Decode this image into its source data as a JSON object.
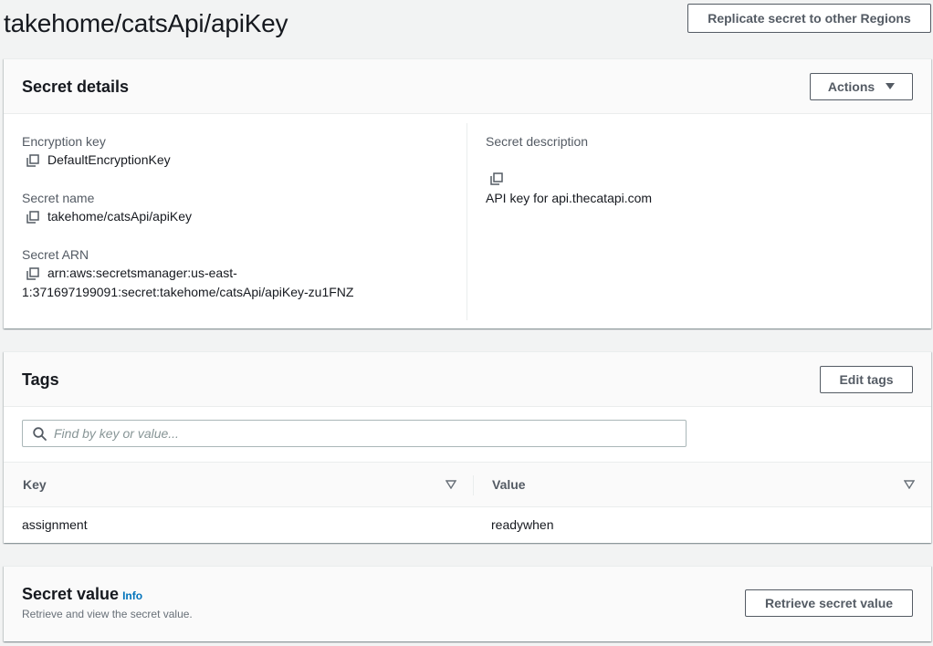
{
  "page": {
    "title": "takehome/catsApi/apiKey",
    "replicate_button": "Replicate secret to other Regions"
  },
  "secret_details": {
    "title": "Secret details",
    "actions_button": "Actions",
    "encryption_key": {
      "label": "Encryption key",
      "value": "DefaultEncryptionKey"
    },
    "secret_name": {
      "label": "Secret name",
      "value": "takehome/catsApi/apiKey"
    },
    "secret_arn": {
      "label": "Secret ARN",
      "value_line1": "arn:aws:secretsmanager:us-east-",
      "value_line2": "1:371697199091:secret:takehome/catsApi/apiKey-zu1FNZ"
    },
    "secret_description": {
      "label": "Secret description",
      "value": "API key for api.thecatapi.com"
    }
  },
  "tags": {
    "title": "Tags",
    "edit_button": "Edit tags",
    "search_placeholder": "Find by key or value...",
    "columns": [
      "Key",
      "Value"
    ],
    "rows": [
      {
        "key": "assignment",
        "value": "readywhen"
      }
    ]
  },
  "secret_value": {
    "title": "Secret value",
    "info_link": "Info",
    "subtitle": "Retrieve and view the secret value.",
    "retrieve_button": "Retrieve secret value"
  },
  "colors": {
    "background": "#f2f3f3",
    "panel_header": "#fafafa",
    "button_border": "#545b64",
    "link": "#0073bb"
  },
  "icons": [
    "copy-icon",
    "search-icon",
    "caret-down-icon",
    "sort-icon"
  ]
}
